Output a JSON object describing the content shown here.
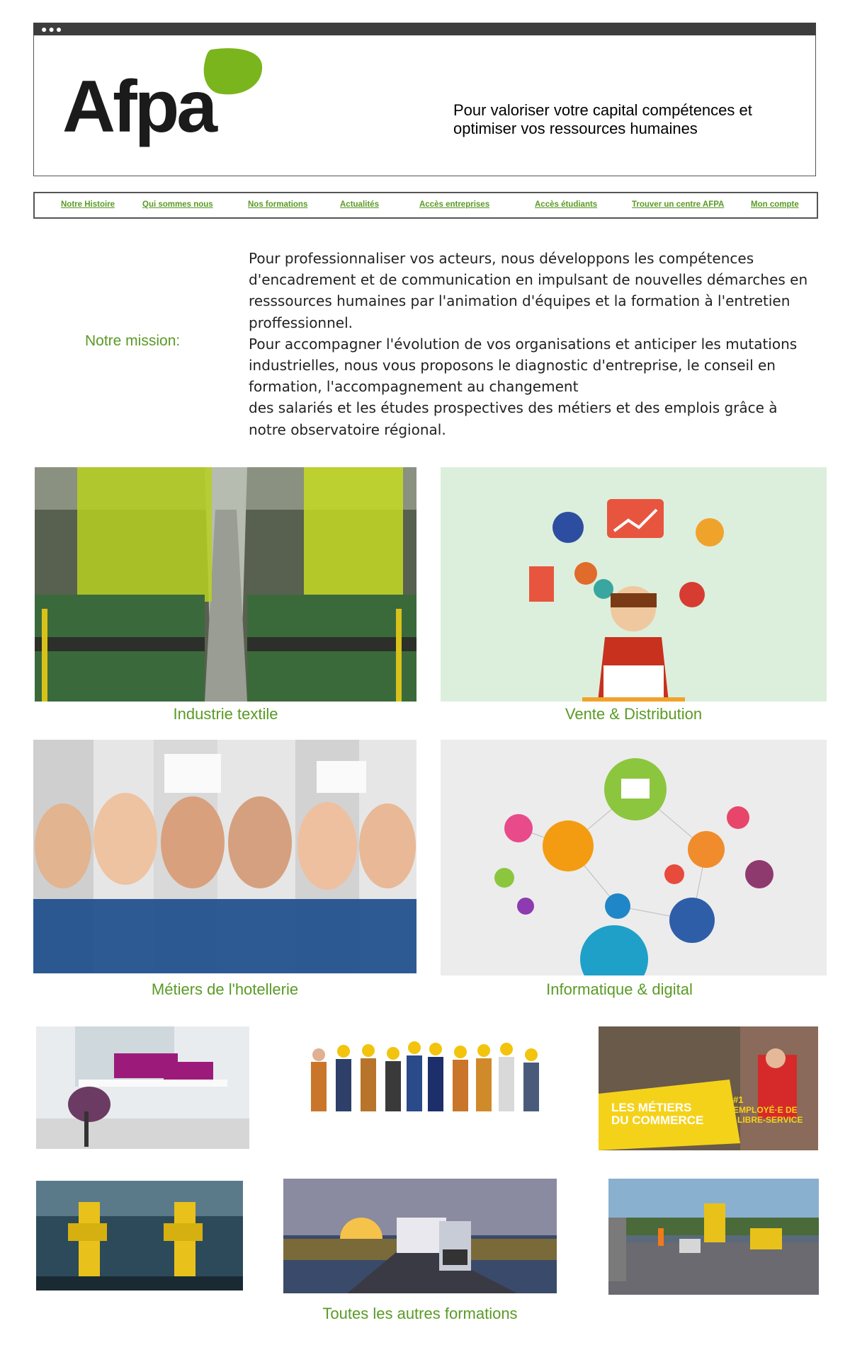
{
  "header": {
    "logo_text": "Afpa",
    "tagline_line1": "Pour valoriser votre capital compétences et",
    "tagline_line2": "optimiser vos ressources humaines"
  },
  "nav": [
    "Notre Histoire",
    "Qui sommes nous",
    "Nos formations",
    "Actualités",
    "Accès entreprises",
    "Accès étudiants",
    "Trouver un centre AFPA",
    "Mon compte"
  ],
  "mission": {
    "label": "Notre mission:",
    "lines": [
      "Pour professionnaliser vos acteurs, nous développons les compétences",
      "d'encadrement et de communication en impulsant de nouvelles démarches en",
      "resssources humaines par l'animation d'équipes et la formation à l'entretien",
      "proffessionnel.",
      "Pour accompagner l'évolution de vos organisations et anticiper les mutations",
      "industrielles, nous vous proposons le diagnostic d'entreprise, le conseil en",
      "formation, l'accompagnement au changement",
      "des salariés et les études prospectives des métiers et des emplois grâce à",
      "notre observatoire régional."
    ]
  },
  "tiles": [
    "Industrie textile",
    "Vente & Distribution",
    "Métiers de l'hotellerie",
    "Informatique & digital"
  ],
  "commerce_banner": {
    "line1": "LES MÉTIERS",
    "line2": "DU COMMERCE",
    "badge": "#1",
    "job_line1": "EMPLOYÉ·E DE",
    "job_line2": "LIBRE-SERVICE"
  },
  "all_trainings_link": "Toutes les autres formations",
  "colors": {
    "accent_green": "#5a9a25",
    "logo_green": "#7ab51d",
    "dark": "#3d3d3d"
  }
}
